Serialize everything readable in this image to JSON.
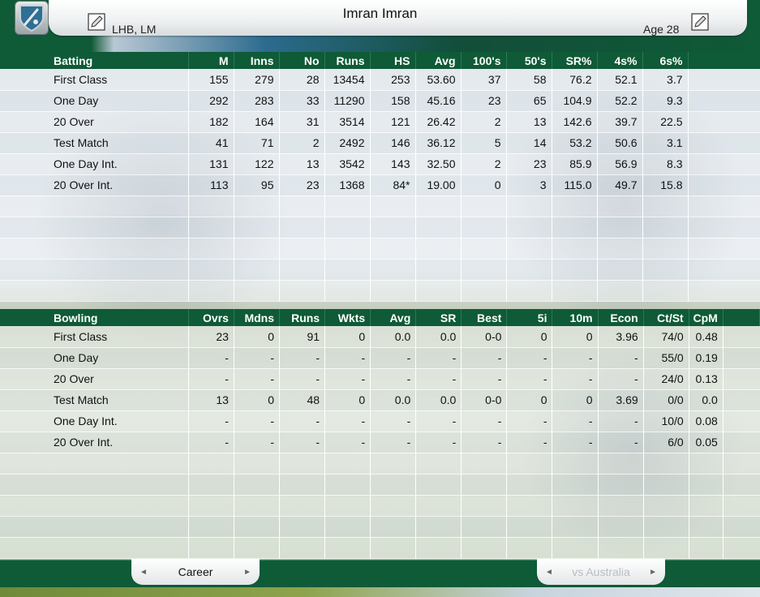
{
  "header": {
    "player_name": "Imran Imran",
    "batting_bowling_style": "LHB, LM",
    "age": "Age 28"
  },
  "batting": {
    "columns": [
      "Batting",
      "M",
      "Inns",
      "No",
      "Runs",
      "HS",
      "Avg",
      "100's",
      "50's",
      "SR%",
      "4s%",
      "6s%"
    ],
    "rows": [
      [
        "First Class",
        "155",
        "279",
        "28",
        "13454",
        "253",
        "53.60",
        "37",
        "58",
        "76.2",
        "52.1",
        "3.7"
      ],
      [
        "One Day",
        "292",
        "283",
        "33",
        "11290",
        "158",
        "45.16",
        "23",
        "65",
        "104.9",
        "52.2",
        "9.3"
      ],
      [
        "20 Over",
        "182",
        "164",
        "31",
        "3514",
        "121",
        "26.42",
        "2",
        "13",
        "142.6",
        "39.7",
        "22.5"
      ],
      [
        "Test Match",
        "41",
        "71",
        "2",
        "2492",
        "146",
        "36.12",
        "5",
        "14",
        "53.2",
        "50.6",
        "3.1"
      ],
      [
        "One Day Int.",
        "131",
        "122",
        "13",
        "3542",
        "143",
        "32.50",
        "2",
        "23",
        "85.9",
        "56.9",
        "8.3"
      ],
      [
        "20 Over Int.",
        "113",
        "95",
        "23",
        "1368",
        "84*",
        "19.00",
        "0",
        "3",
        "115.0",
        "49.7",
        "15.8"
      ]
    ]
  },
  "bowling": {
    "columns": [
      "Bowling",
      "Ovrs",
      "Mdns",
      "Runs",
      "Wkts",
      "Avg",
      "SR",
      "Best",
      "5i",
      "10m",
      "Econ",
      "Ct/St",
      "CpM"
    ],
    "rows": [
      [
        "First Class",
        "23",
        "0",
        "91",
        "0",
        "0.0",
        "0.0",
        "0-0",
        "0",
        "0",
        "3.96",
        "74/0",
        "0.48"
      ],
      [
        "One Day",
        "-",
        "-",
        "-",
        "-",
        "-",
        "-",
        "-",
        "-",
        "-",
        "-",
        "55/0",
        "0.19"
      ],
      [
        "20 Over",
        "-",
        "-",
        "-",
        "-",
        "-",
        "-",
        "-",
        "-",
        "-",
        "-",
        "24/0",
        "0.13"
      ],
      [
        "Test Match",
        "13",
        "0",
        "48",
        "0",
        "0.0",
        "0.0",
        "0-0",
        "0",
        "0",
        "3.69",
        "0/0",
        "0.0"
      ],
      [
        "One Day Int.",
        "-",
        "-",
        "-",
        "-",
        "-",
        "-",
        "-",
        "-",
        "-",
        "-",
        "10/0",
        "0.08"
      ],
      [
        "20 Over Int.",
        "-",
        "-",
        "-",
        "-",
        "-",
        "-",
        "-",
        "-",
        "-",
        "-",
        "6/0",
        "0.05"
      ]
    ]
  },
  "footer": {
    "left_tab": "Career",
    "right_tab": "vs Australia"
  },
  "colors": {
    "header_green": "#0f5a37"
  }
}
